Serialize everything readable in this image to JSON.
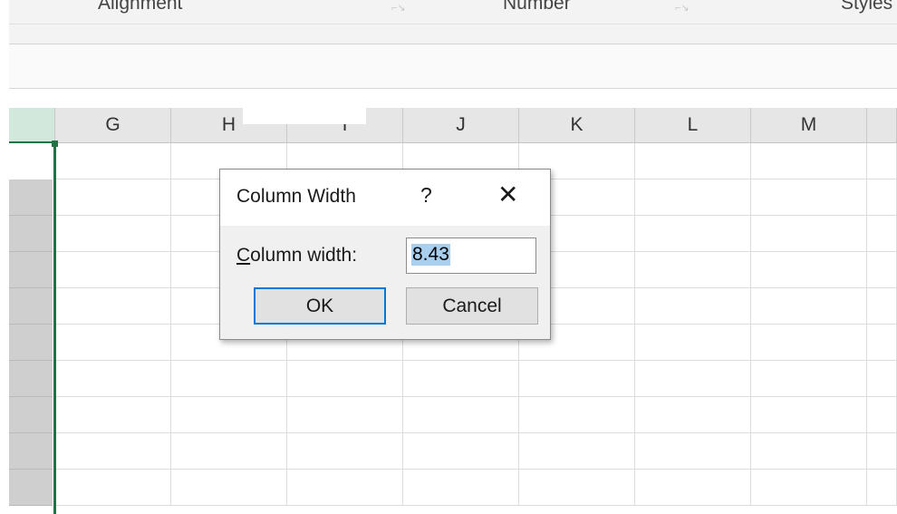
{
  "ribbon": {
    "groups": [
      {
        "label": "Alignment"
      },
      {
        "label": "Number"
      },
      {
        "label": "Styles"
      }
    ]
  },
  "grid": {
    "columns": [
      "",
      "G",
      "H",
      "I",
      "J",
      "K",
      "L",
      "M",
      ""
    ],
    "selected_column_index": 0,
    "row_count": 10
  },
  "dialog": {
    "title": "Column Width",
    "help_icon": "?",
    "close_icon": "✕",
    "label_underlined": "C",
    "label_rest": "olumn width:",
    "input_value": "8.43",
    "ok_label": "OK",
    "cancel_label": "Cancel"
  },
  "colors": {
    "accent": "#217346",
    "focus": "#0078d7",
    "selection": "#a9cfee"
  }
}
